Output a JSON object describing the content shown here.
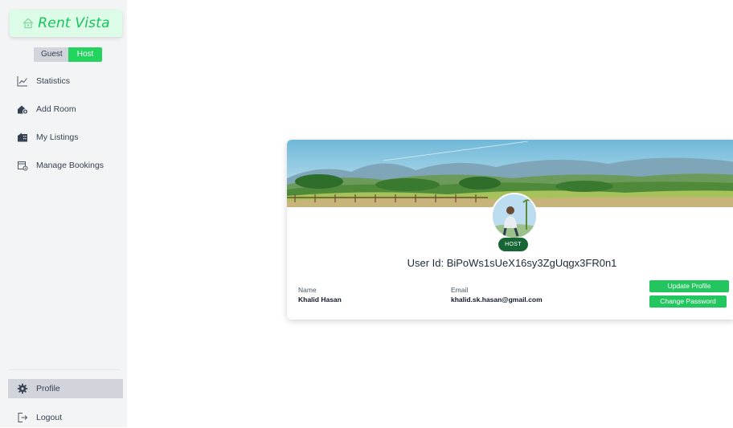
{
  "brand": {
    "name": "Rent Vista"
  },
  "role_toggle": {
    "guest": "Guest",
    "host": "Host",
    "active": "Host"
  },
  "sidebar": {
    "items": [
      {
        "label": "Statistics",
        "icon": "chart-line-icon"
      },
      {
        "label": "Add Room",
        "icon": "house-add-icon"
      },
      {
        "label": "My Listings",
        "icon": "building-icon"
      },
      {
        "label": "Manage Bookings",
        "icon": "calendar-gear-icon"
      }
    ],
    "bottom": [
      {
        "label": "Profile",
        "icon": "gear-icon",
        "active": true
      },
      {
        "label": "Logout",
        "icon": "logout-icon"
      }
    ]
  },
  "profile": {
    "role_badge": "HOST",
    "user_id_text": "User Id: BiPoWs1sUeX16sy3ZgUqgx3FR0n1",
    "name_label": "Name",
    "name": "Khalid Hasan",
    "email_label": "Email",
    "email": "khalid.sk.hasan@gmail.com",
    "update_button": "Update Profile",
    "change_password_button": "Change Password"
  },
  "colors": {
    "accent": "#22c55e",
    "brand_text": "#16c45b",
    "badge": "#166534",
    "sidebar_bg": "#f3f4f6",
    "active_item_bg": "#d1d5db"
  }
}
